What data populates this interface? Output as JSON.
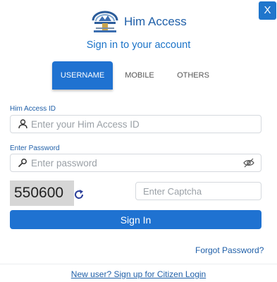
{
  "close_label": "X",
  "brand": {
    "name": "Him Access",
    "logo_icon": "him-access-logo"
  },
  "subtitle": "Sign in to your account",
  "tabs": [
    {
      "label": "USERNAME",
      "active": true
    },
    {
      "label": "MOBILE",
      "active": false
    },
    {
      "label": "OTHERS",
      "active": false
    }
  ],
  "form": {
    "id_label": "Him Access ID",
    "id_placeholder": "Enter your Him Access ID",
    "id_value": "",
    "password_label": "Enter Password",
    "password_placeholder": "Enter password",
    "password_value": "",
    "captcha_text": "550600",
    "captcha_placeholder": "Enter Captcha",
    "captcha_value": "",
    "submit_label": "Sign In"
  },
  "links": {
    "forgot_password": "Forgot Password?",
    "new_user": "New user? Sign up for Citizen Login"
  },
  "colors": {
    "primary": "#1f72d1",
    "link": "#1f5fa8",
    "captcha_bg": "#d6d6d6"
  }
}
